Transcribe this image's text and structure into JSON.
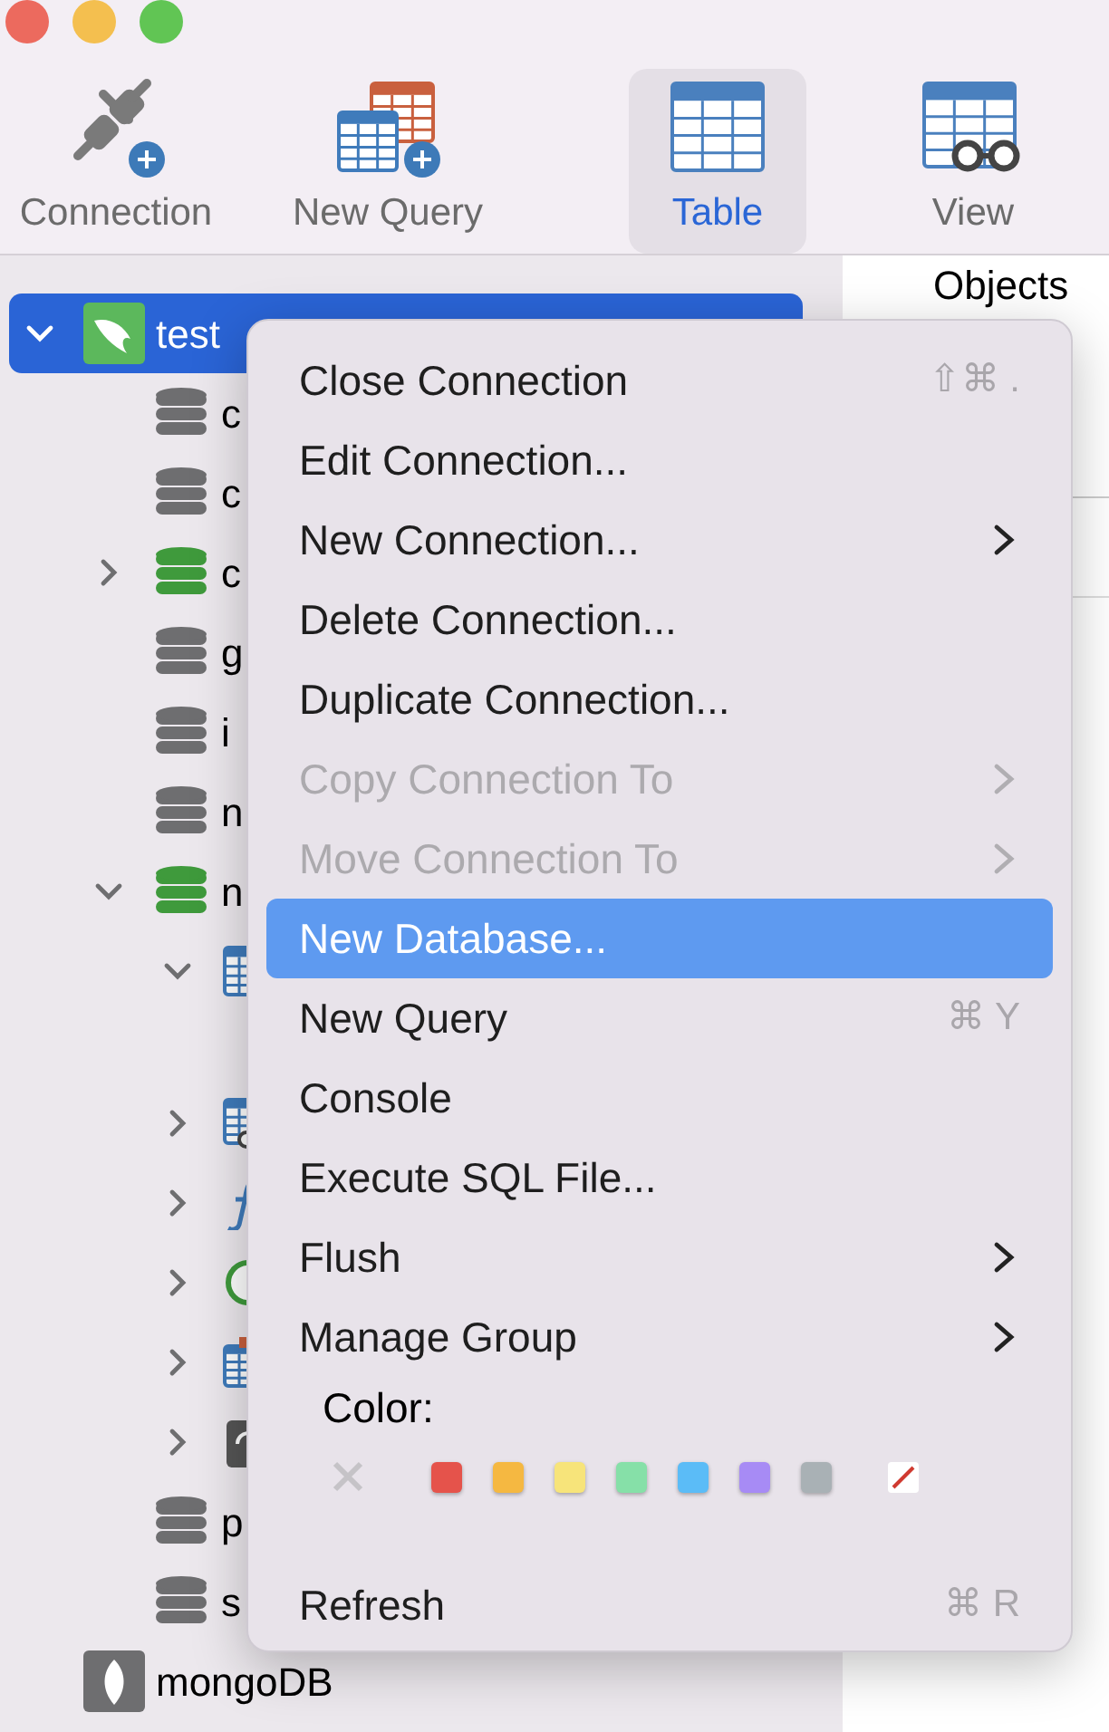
{
  "toolbar": [
    {
      "label": "Connection",
      "kind": "connection",
      "selected": false
    },
    {
      "label": "New Query",
      "kind": "query",
      "selected": false
    },
    {
      "label": "Table",
      "kind": "table",
      "selected": true
    },
    {
      "label": "View",
      "kind": "view",
      "selected": false
    }
  ],
  "tree": [
    {
      "label": "test",
      "kind": "mysql",
      "expanded": true,
      "selected": true,
      "children": [
        {
          "label": "c",
          "kind": "db",
          "connected": false
        },
        {
          "label": "c",
          "kind": "db",
          "connected": false
        },
        {
          "label": "c",
          "kind": "db",
          "connected": true,
          "expanded": false
        },
        {
          "label": "g",
          "kind": "db",
          "connected": false
        },
        {
          "label": "i",
          "kind": "db",
          "connected": false
        },
        {
          "label": "n",
          "kind": "db",
          "connected": false
        },
        {
          "label": "n",
          "kind": "db",
          "connected": true,
          "expanded": true,
          "children": [
            {
              "kind": "tables",
              "expanded": true
            },
            {
              "kind": "views",
              "expanded": false
            },
            {
              "kind": "functions",
              "expanded": false
            },
            {
              "kind": "events",
              "expanded": false
            },
            {
              "kind": "queries",
              "expanded": false
            },
            {
              "kind": "backups",
              "expanded": false
            }
          ]
        },
        {
          "label": "p",
          "kind": "db",
          "connected": false
        },
        {
          "label": "s",
          "kind": "db",
          "connected": false
        }
      ]
    },
    {
      "label": "mongoDB",
      "kind": "mongo",
      "selected": false
    }
  ],
  "right_pane": {
    "tab": "Objects"
  },
  "context_menu": [
    {
      "kind": "item",
      "label": "Close Connection",
      "shortcut": "⇧⌘ .",
      "submenu": false,
      "disabled": false,
      "selected": false
    },
    {
      "kind": "item",
      "label": "Edit Connection...",
      "submenu": false,
      "disabled": false,
      "selected": false
    },
    {
      "kind": "item",
      "label": "New Connection...",
      "submenu": true,
      "disabled": false,
      "selected": false
    },
    {
      "kind": "item",
      "label": "Delete Connection...",
      "submenu": false,
      "disabled": false,
      "selected": false
    },
    {
      "kind": "item",
      "label": "Duplicate Connection...",
      "submenu": false,
      "disabled": false,
      "selected": false
    },
    {
      "kind": "item",
      "label": "Copy Connection To",
      "submenu": true,
      "disabled": true,
      "selected": false
    },
    {
      "kind": "item",
      "label": "Move Connection To",
      "submenu": true,
      "disabled": true,
      "selected": false
    },
    {
      "kind": "item",
      "label": "New Database...",
      "submenu": false,
      "disabled": false,
      "selected": true
    },
    {
      "kind": "item",
      "label": "New Query",
      "shortcut": "⌘ Y",
      "submenu": false,
      "disabled": false,
      "selected": false
    },
    {
      "kind": "item",
      "label": "Console",
      "submenu": false,
      "disabled": false,
      "selected": false
    },
    {
      "kind": "item",
      "label": "Execute SQL File...",
      "submenu": false,
      "disabled": false,
      "selected": false
    },
    {
      "kind": "item",
      "label": "Flush",
      "submenu": true,
      "disabled": false,
      "selected": false
    },
    {
      "kind": "item",
      "label": "Manage Group",
      "submenu": true,
      "disabled": false,
      "selected": false
    },
    {
      "kind": "colors",
      "label": "Color:",
      "swatches": [
        {
          "kind": "none"
        },
        {
          "kind": "color",
          "color": "#e5534b"
        },
        {
          "kind": "color",
          "color": "#f5b841"
        },
        {
          "kind": "color",
          "color": "#f7e47a"
        },
        {
          "kind": "color",
          "color": "#86e0a8"
        },
        {
          "kind": "color",
          "color": "#5bbcf7"
        },
        {
          "kind": "color",
          "color": "#a78bf5"
        },
        {
          "kind": "color",
          "color": "#a9b1b5"
        },
        {
          "kind": "custom"
        }
      ]
    },
    {
      "kind": "item",
      "label": "Refresh",
      "shortcut": "⌘ R",
      "submenu": false,
      "disabled": false,
      "selected": false
    }
  ]
}
